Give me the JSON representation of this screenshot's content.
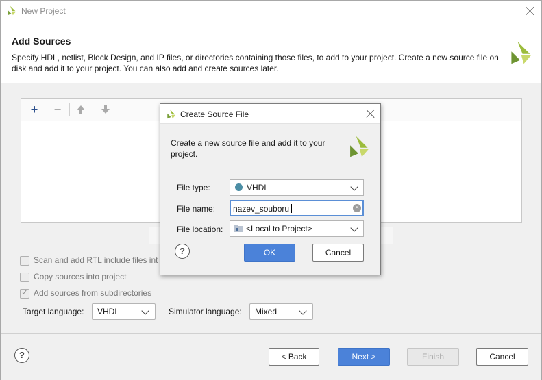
{
  "window": {
    "title": "New Project",
    "heading": "Add Sources",
    "description": "Specify HDL, netlist, Block Design, and IP files, or directories containing those files, to add to your project. Create a new source file on disk and add it to your project. You can also add and create sources later."
  },
  "options": {
    "scan_rtl": {
      "label": "Scan and add RTL include files int",
      "checked": false
    },
    "copy_sources": {
      "label": "Copy sources into project",
      "checked": false
    },
    "add_subdirs": {
      "label": "Add sources from subdirectories",
      "checked": true
    },
    "target_language_label": "Target language:",
    "target_language_value": "VHDL",
    "simulator_language_label": "Simulator language:",
    "simulator_language_value": "Mixed"
  },
  "footer": {
    "help": "?",
    "back_label": "< Back",
    "next_label": "Next >",
    "finish_label": "Finish",
    "cancel_label": "Cancel"
  },
  "dialog": {
    "title": "Create Source File",
    "description": "Create a new source file and add it to your project.",
    "file_type_label": "File type:",
    "file_type_value": "VHDL",
    "file_name_label": "File name:",
    "file_name_value": "nazev_souboru",
    "file_location_label": "File location:",
    "file_location_value": "<Local to Project>",
    "help": "?",
    "ok_label": "OK",
    "cancel_label": "Cancel"
  },
  "colors": {
    "logo_green": "#9cbc3c",
    "logo_dark": "#5f7f2a",
    "primary_button": "#4b82d9",
    "vhdl_dot": "#4c8ea5"
  },
  "icons": [
    "vivado-logo-icon",
    "close-icon",
    "add-icon",
    "remove-icon",
    "move-up-icon",
    "move-down-icon",
    "help-icon",
    "chevron-down-icon",
    "clear-icon",
    "folder-icon"
  ]
}
